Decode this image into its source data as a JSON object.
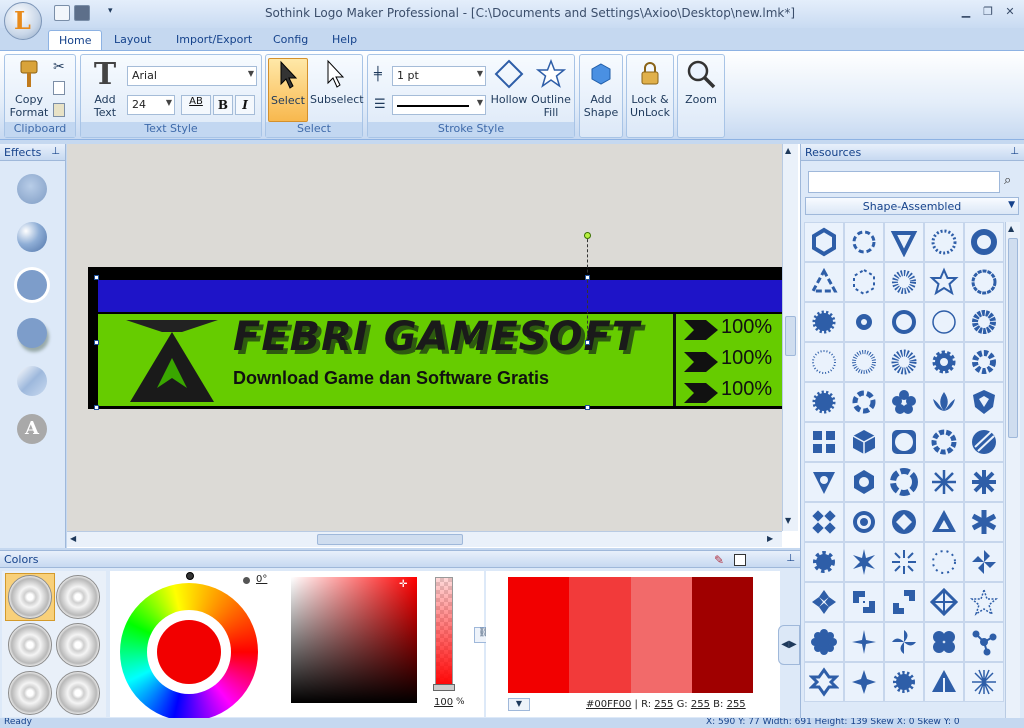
{
  "window": {
    "title": "Sothink Logo Maker Professional - [C:\\Documents and Settings\\Axioo\\Desktop\\new.lmk*]",
    "app_icon": "logo-icon",
    "controls": [
      "minimize-icon",
      "restore-icon",
      "close-icon"
    ]
  },
  "tabs": [
    {
      "label": "Home",
      "active": true
    },
    {
      "label": "Layout"
    },
    {
      "label": "Import/Export"
    },
    {
      "label": "Config"
    },
    {
      "label": "Help"
    }
  ],
  "ribbon": {
    "clipboard": {
      "label": "Clipboard",
      "copy_format": "Copy Format"
    },
    "text_style": {
      "label": "Text Style",
      "add_text": "Add Text",
      "font": "Arial",
      "size": "24",
      "bold": "B",
      "italic": "I",
      "ab": "AB"
    },
    "select": {
      "label": "Select",
      "select": "Select",
      "subselect": "Subselect"
    },
    "stroke_style": {
      "label": "Stroke Style",
      "width": "1 pt",
      "hollow": "Hollow",
      "outline_fill": "Outline Fill"
    },
    "add_shape": "Add Shape",
    "lock": "Lock & UnLock",
    "zoom": "Zoom"
  },
  "effects": {
    "title": "Effects",
    "letter": "A"
  },
  "resources": {
    "title": "Resources",
    "category": "Shape-Assembled"
  },
  "logo": {
    "title": "FEBRI GAMESOFT",
    "subtitle": "Download Game dan Software Gratis",
    "percents": [
      "100%",
      "100%",
      "100%"
    ],
    "colors": {
      "green": "#66cc00",
      "blue": "#1e14c8",
      "black": "#000000"
    }
  },
  "colors": {
    "title": "Colors",
    "angle": "0°",
    "opacity": "100",
    "percent": "%",
    "hex": "#00FF00",
    "r_label": "R:",
    "r": "255",
    "g_label": "G:",
    "g": "255",
    "b_label": "B:",
    "b": "255",
    "swatches": [
      "#f20000",
      "#f23a3a",
      "#f26a6a",
      "#a00000"
    ]
  },
  "status": {
    "left": "Ready",
    "right": "X: 590 Y: 77 Width: 691 Height: 139 Skew X: 0 Skew Y: 0"
  }
}
